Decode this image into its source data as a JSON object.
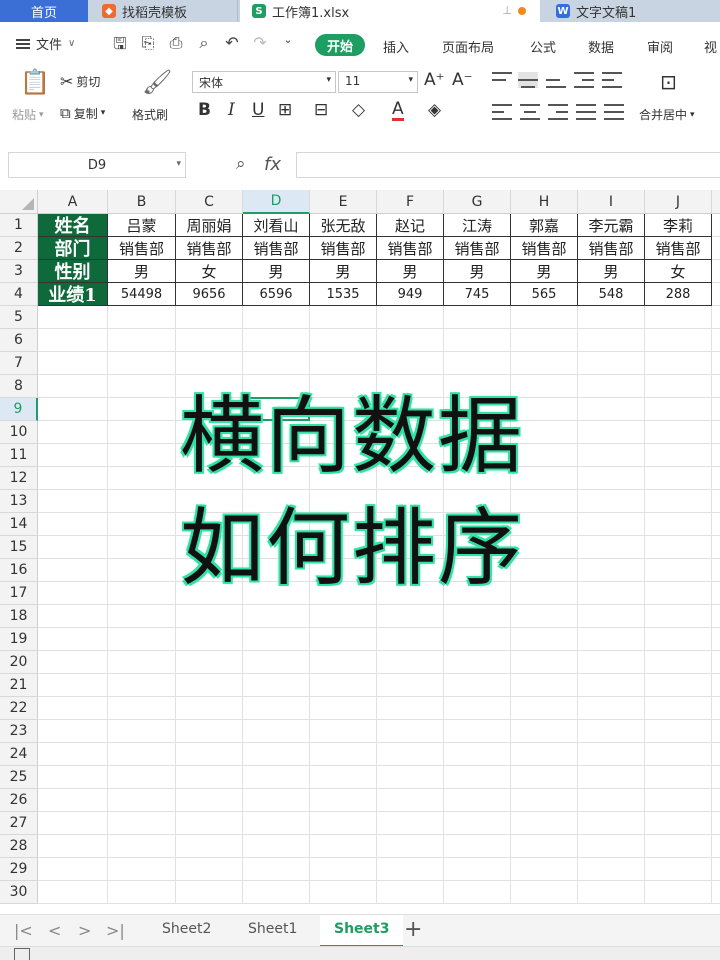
{
  "tabs": {
    "home": "首页",
    "template": "找稻壳模板",
    "workbook": "工作簿1.xlsx",
    "doc": "文字文稿1"
  },
  "menu": {
    "file": "文件",
    "items": [
      "开始",
      "插入",
      "页面布局",
      "公式",
      "数据",
      "审阅",
      "视"
    ]
  },
  "ribbon": {
    "paste": "粘贴",
    "cut": "剪切",
    "copy": "复制",
    "format_painter": "格式刷",
    "font": "宋体",
    "size": "11",
    "merge": "合并居中"
  },
  "formula_bar": {
    "cell_ref": "D9",
    "fx": "fx",
    "content": ""
  },
  "columns": [
    "A",
    "B",
    "C",
    "D",
    "E",
    "F",
    "G",
    "H",
    "I",
    "J"
  ],
  "rows": [
    "1",
    "2",
    "3",
    "4",
    "5",
    "6",
    "7",
    "8",
    "9",
    "10",
    "11",
    "12",
    "13",
    "14",
    "15",
    "16",
    "17",
    "18",
    "19",
    "20",
    "21",
    "22",
    "23",
    "24",
    "25",
    "26",
    "27",
    "28",
    "29",
    "30"
  ],
  "table": [
    [
      "姓名",
      "吕蒙",
      "周丽娟",
      "刘看山",
      "张无敌",
      "赵记",
      "江涛",
      "郭嘉",
      "李元霸",
      "李莉"
    ],
    [
      "部门",
      "销售部",
      "销售部",
      "销售部",
      "销售部",
      "销售部",
      "销售部",
      "销售部",
      "销售部",
      "销售部"
    ],
    [
      "性别",
      "男",
      "女",
      "男",
      "男",
      "男",
      "男",
      "男",
      "男",
      "女"
    ],
    [
      "业绩1",
      "54498",
      "9656",
      "6596",
      "1535",
      "949",
      "745",
      "565",
      "548",
      "288"
    ]
  ],
  "overlay": {
    "line1": "横向数据",
    "line2": "如何排序"
  },
  "sheets": [
    "Sheet2",
    "Sheet1",
    "Sheet3"
  ],
  "active_sheet": "Sheet3",
  "colors": {
    "accent": "#1e9e62",
    "header_fill": "#0e6a3a",
    "overlay_glow": "#33e0a6"
  }
}
